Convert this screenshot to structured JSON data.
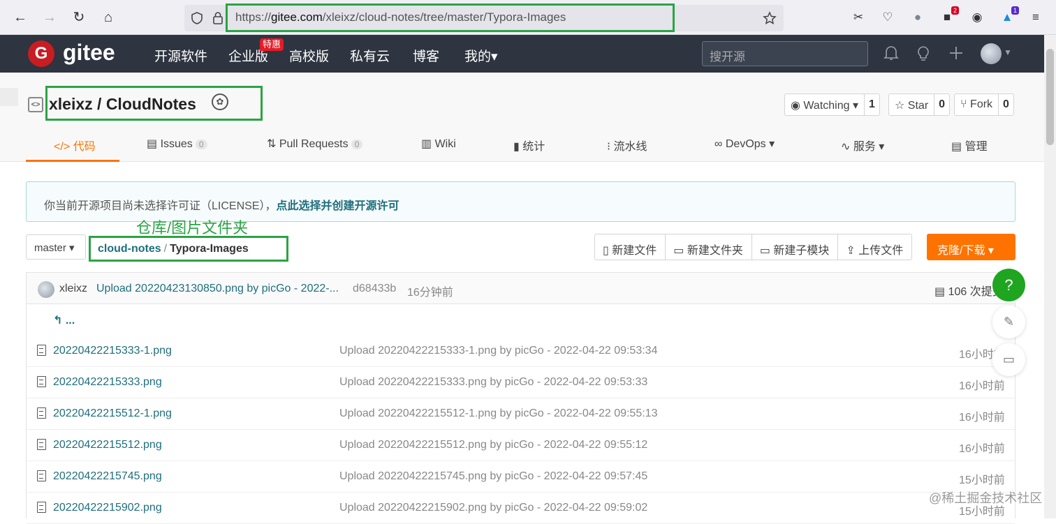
{
  "browser": {
    "back_icon": "←",
    "forward_icon": "→",
    "reload_icon": "↻",
    "home_icon": "⌂",
    "url_prefix": "https://",
    "url_host": "gitee.com",
    "url_path": "/xleixz/cloud-notes/tree/master/Typora-Images",
    "ext_badge_1": "2",
    "ext_badge_2": "1"
  },
  "nav": {
    "logo_letter": "G",
    "logo_text": "gitee",
    "items": [
      "开源软件",
      "企业版",
      "高校版",
      "私有云",
      "博客",
      "我的▾"
    ],
    "promo_tag": "特惠",
    "search_placeholder": "搜开源"
  },
  "repo": {
    "icon": "<>",
    "title": "xleixz / CloudNotes",
    "watching_label": "Watching ▾",
    "watching_count": "1",
    "star_label": "Star",
    "star_count": "0",
    "fork_label": "Fork",
    "fork_count": "0"
  },
  "tabs": [
    {
      "label": "</> 代码",
      "count": ""
    },
    {
      "label": "Issues",
      "count": "0"
    },
    {
      "label": "Pull Requests",
      "count": "0"
    },
    {
      "label": "Wiki",
      "count": ""
    },
    {
      "label": "统计",
      "count": ""
    },
    {
      "label": "流水线",
      "count": ""
    },
    {
      "label": "DevOps ▾",
      "count": ""
    },
    {
      "label": "服务 ▾",
      "count": ""
    },
    {
      "label": "管理",
      "count": ""
    }
  ],
  "notice": {
    "text": "你当前开源项目尚未选择许可证（LICENSE），",
    "link": "点此选择并创建开源许可"
  },
  "annotation": "仓库/图片文件夹",
  "branch": {
    "name": "master ▾",
    "crumb_root": "cloud-notes",
    "crumb_sep": "/",
    "crumb_current": "Typora-Images"
  },
  "actions": [
    "新建文件",
    "新建文件夹",
    "新建子模块",
    "上传文件"
  ],
  "clone_label": "克隆/下载 ▾",
  "commit": {
    "author": "xleixz",
    "message": "Upload 20220423130850.png by picGo - 2022-...",
    "hash": "d68433b",
    "time": "16分钟前",
    "count": "106 次提交"
  },
  "back_label": "↰ ...",
  "files": [
    {
      "name": "20220422215333-1.png",
      "message": "Upload 20220422215333-1.png by picGo - 2022-04-22 09:53:34",
      "time": "16小时前"
    },
    {
      "name": "20220422215333.png",
      "message": "Upload 20220422215333.png by picGo - 2022-04-22 09:53:33",
      "time": "16小时前"
    },
    {
      "name": "20220422215512-1.png",
      "message": "Upload 20220422215512-1.png by picGo - 2022-04-22 09:55:13",
      "time": "16小时前"
    },
    {
      "name": "20220422215512.png",
      "message": "Upload 20220422215512.png by picGo - 2022-04-22 09:55:12",
      "time": "16小时前"
    },
    {
      "name": "20220422215745.png",
      "message": "Upload 20220422215745.png by picGo - 2022-04-22 09:57:45",
      "time": "15小时前"
    },
    {
      "name": "20220422215902.png",
      "message": "Upload 20220422215902.png by picGo - 2022-04-22 09:59:02",
      "time": "15小时前"
    }
  ],
  "float": {
    "help": "?"
  },
  "watermark": "@稀土掘金技术社区",
  "colors": {
    "accent": "#fe7300",
    "annotation": "#2aa444",
    "nav_bg": "#2e3440",
    "link": "#1e6f7c"
  }
}
